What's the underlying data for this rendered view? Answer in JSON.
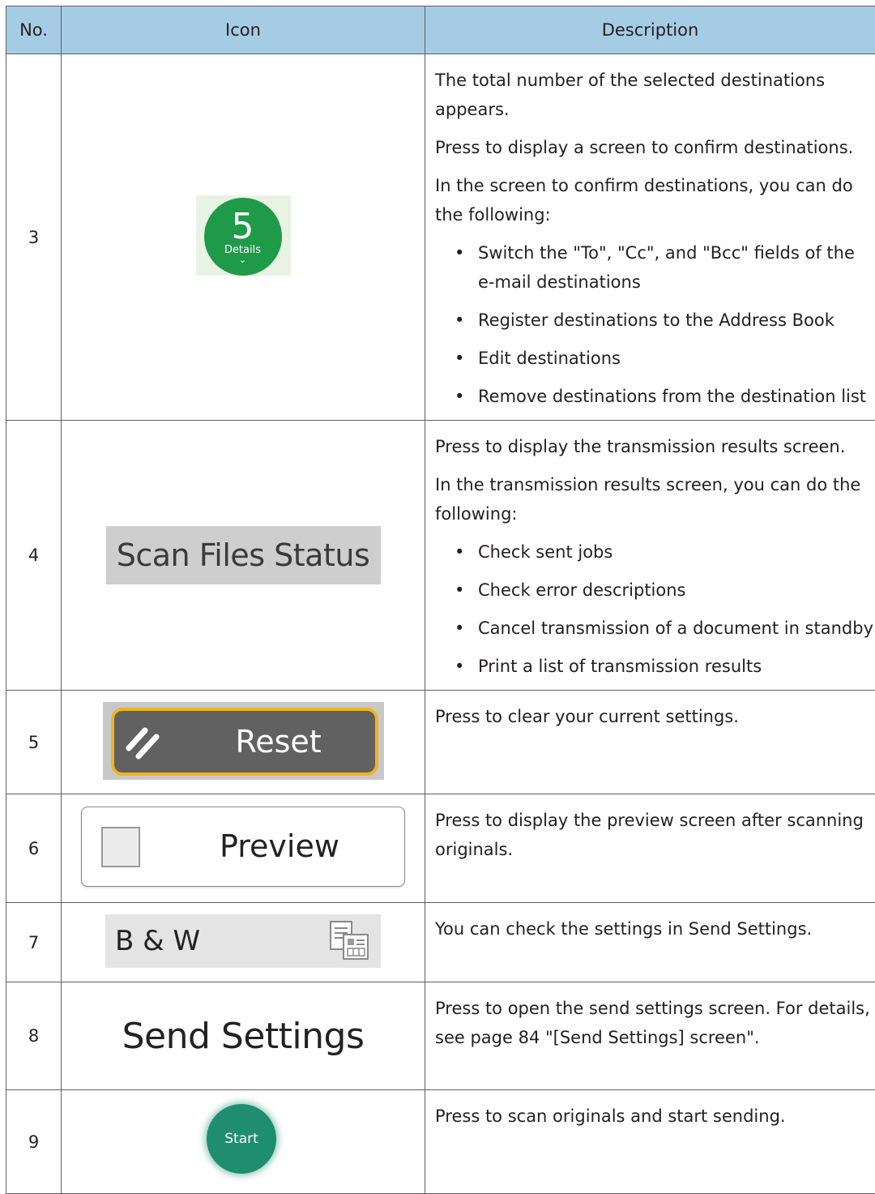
{
  "table": {
    "headers": {
      "no": "No.",
      "icon": "Icon",
      "description": "Description"
    },
    "rows": [
      {
        "no": "3",
        "icon": {
          "name": "details-icon",
          "count": "5",
          "label": "Details",
          "chevron": "⌄",
          "color": "#1f9a49"
        },
        "paragraphs": [
          "The total number of the selected destinations appears.",
          "Press to display a screen to confirm destinations.",
          "In the screen to confirm destinations, you can do the following:"
        ],
        "bullets": [
          "Switch the \"To\", \"Cc\", and \"Bcc\" fields of the e-mail destinations",
          "Register destinations to the Address Book",
          "Edit destinations",
          "Remove destinations from the destination list"
        ]
      },
      {
        "no": "4",
        "icon": {
          "name": "scan-files-status-button",
          "label": "Scan Files Status"
        },
        "paragraphs": [
          "Press to display the transmission results screen.",
          "In the transmission results screen, you can do the following:"
        ],
        "bullets": [
          "Check sent jobs",
          "Check error descriptions",
          "Cancel transmission of a document in standby",
          "Print a list of transmission results"
        ]
      },
      {
        "no": "5",
        "icon": {
          "name": "reset-button",
          "label": "Reset",
          "border_color": "#f0b41e"
        },
        "paragraphs": [
          "Press to clear your current settings."
        ]
      },
      {
        "no": "6",
        "icon": {
          "name": "preview-checkbox",
          "label": "Preview"
        },
        "paragraphs": [
          "Press to display the preview screen after scanning originals."
        ]
      },
      {
        "no": "7",
        "icon": {
          "name": "bw-settings-bar",
          "label": "B & W",
          "side_icon": "send-settings-icon"
        },
        "paragraphs": [
          "You can check the settings in Send Settings."
        ]
      },
      {
        "no": "8",
        "icon": {
          "name": "send-settings-button",
          "label": "Send Settings"
        },
        "paragraphs": [
          "Press to open the send settings screen. For details, see page 84 \"[Send Settings] screen\"."
        ]
      },
      {
        "no": "9",
        "icon": {
          "name": "start-button",
          "label": "Start",
          "color": "#1f8e6e"
        },
        "paragraphs": [
          "Press to scan originals and start sending."
        ]
      }
    ]
  }
}
